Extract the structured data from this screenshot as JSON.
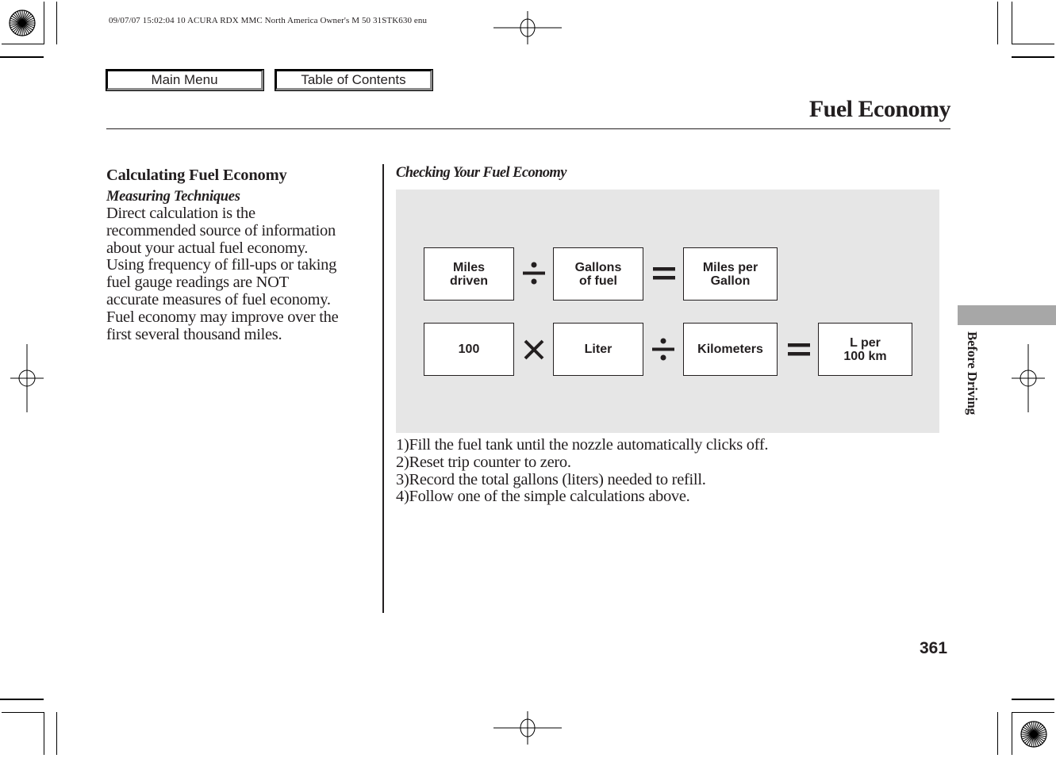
{
  "print_header": {
    "meta_text": "09/07/07 15:02:04    10 ACURA RDX MMC North America Owner's M 50 31STK630 enu"
  },
  "nav": {
    "main_menu_label": "Main Menu",
    "toc_label": "Table of Contents"
  },
  "page": {
    "title": "Fuel Economy",
    "side_tab_label": "Before Driving",
    "page_number": "361"
  },
  "left_column": {
    "heading": "Calculating Fuel Economy",
    "subheading": "Measuring Techniques",
    "lines": [
      "Direct calculation is the",
      "recommended source of information",
      "about your actual fuel economy.",
      "Using frequency of fill-ups or taking",
      "fuel gauge readings are NOT",
      "accurate measures of fuel economy.",
      "Fuel economy may improve over the",
      "first several thousand miles."
    ]
  },
  "right_column": {
    "heading": "Checking Your Fuel Economy",
    "formulas": [
      {
        "name": "mpg",
        "terms": [
          "Miles\ndriven",
          "Gallons\nof fuel",
          "Miles per\nGallon"
        ],
        "operators": [
          "divide",
          "equals"
        ]
      },
      {
        "name": "l-per-100km",
        "terms": [
          "100",
          "Liter",
          "Kilometers",
          "L per\n100 km"
        ],
        "operators": [
          "multiply",
          "divide",
          "equals"
        ]
      }
    ],
    "steps": [
      "1)Fill the fuel tank until the nozzle automatically clicks off.",
      "2)Reset trip counter to zero.",
      "3)Record the total gallons (liters) needed to refill.",
      "4)Follow one of the simple calculations above."
    ]
  },
  "colors": {
    "text": "#231f20",
    "diagram_bg": "#e6e6e6",
    "side_tab": "#a7a7a7"
  }
}
